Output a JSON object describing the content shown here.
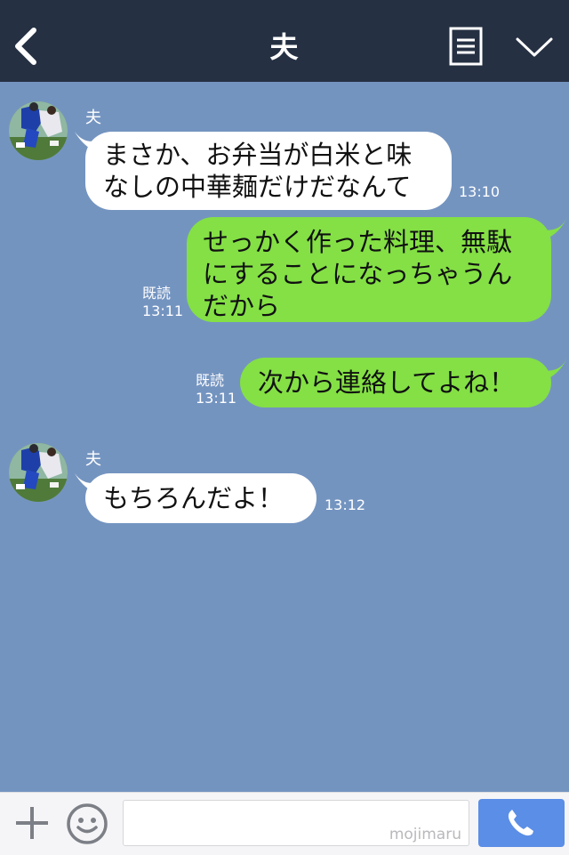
{
  "header": {
    "title": "夫",
    "back_icon": "chevron-left-icon",
    "menu_icon": "list-icon",
    "expand_icon": "chevron-down-icon"
  },
  "messages": [
    {
      "direction": "in",
      "sender": "夫",
      "lines": [
        "まさか、お弁当が白米と味",
        "なしの中華麺だけだなんて"
      ],
      "time": "13:10"
    },
    {
      "direction": "out",
      "read_label": "既読",
      "lines": [
        "せっかく作った料理、無駄",
        "にすることになっちゃうん",
        "だから"
      ],
      "time": "13:11"
    },
    {
      "direction": "out",
      "read_label": "既読",
      "lines": [
        "次から連絡してよね！"
      ],
      "time": "13:11"
    },
    {
      "direction": "in",
      "sender": "夫",
      "lines": [
        "もちろんだよ！"
      ],
      "time": "13:12"
    }
  ],
  "input": {
    "placeholder": "",
    "watermark": "mojimaru"
  },
  "icons": {
    "plus": "plus-icon",
    "emoji": "smiley-icon",
    "call": "phone-icon"
  },
  "colors": {
    "header_bg": "#253043",
    "chat_bg": "#7494c0",
    "bubble_in": "#ffffff",
    "bubble_out": "#84e045",
    "call_button": "#5b8ee6"
  }
}
